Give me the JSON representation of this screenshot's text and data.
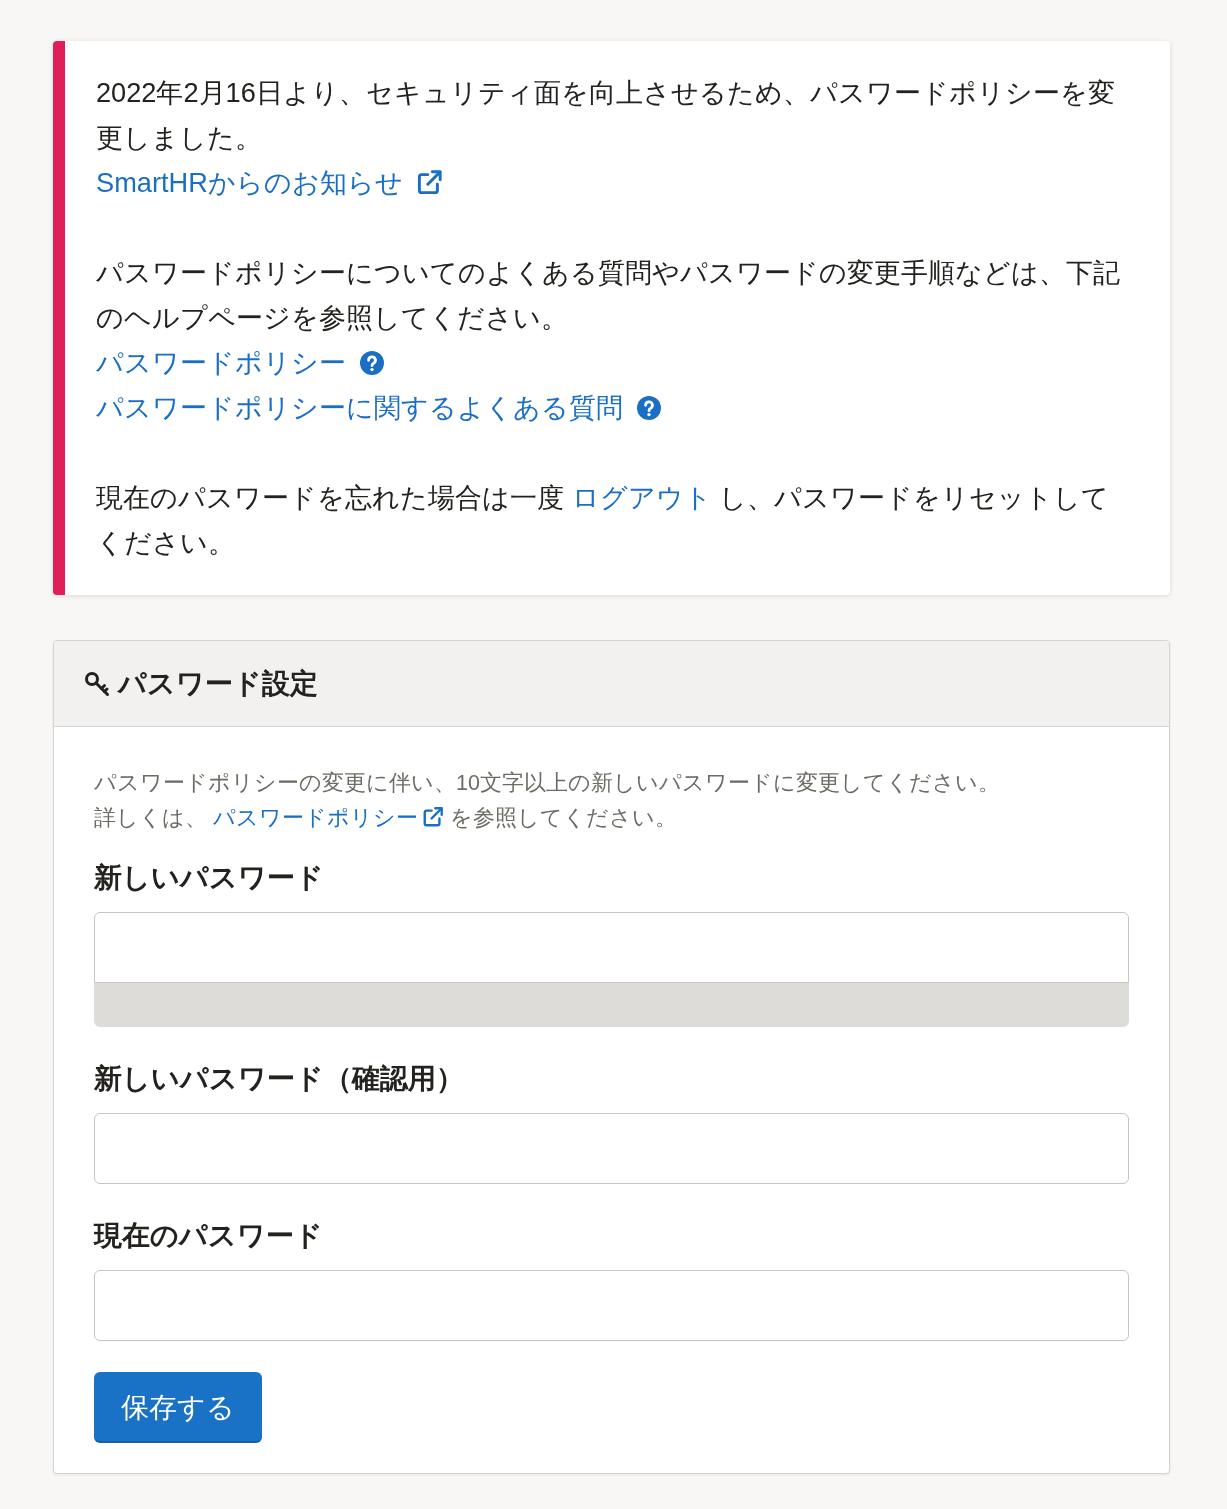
{
  "notice": {
    "paragraphs": [
      {
        "kind": "text_with_links",
        "text": "2022年2月16日より、セキュリティ面を向上させるため、パスワードポリシーを変更しました。",
        "links": [
          {
            "label": "SmartHRからのお知らせ",
            "kind": "external"
          }
        ]
      },
      {
        "kind": "text_with_links",
        "text": "パスワードポリシーについてのよくある質問やパスワードの変更手順などは、下記のヘルプページを参照してください。",
        "links": [
          {
            "label": "パスワードポリシー",
            "kind": "help"
          },
          {
            "label": "パスワードポリシーに関するよくある質問",
            "kind": "help"
          }
        ]
      },
      {
        "kind": "inline_link",
        "before": "現在のパスワードを忘れた場合は一度",
        "link": "ログアウト",
        "after": "し、パスワードをリセットしてください。"
      }
    ]
  },
  "password_settings": {
    "title": "パスワード設定",
    "description": "パスワードポリシーの変更に伴い、10文字以上の新しいパスワードに変更してください。",
    "detail": {
      "before": "詳しくは、",
      "link": "パスワードポリシー",
      "after": "を参照してください。"
    },
    "fields": [
      {
        "label": "新しいパスワード",
        "strength_meter": {
          "level": 0
        }
      },
      {
        "label": "新しいパスワード（確認用）"
      },
      {
        "label": "現在のパスワード"
      }
    ],
    "submit": "保存する"
  }
}
